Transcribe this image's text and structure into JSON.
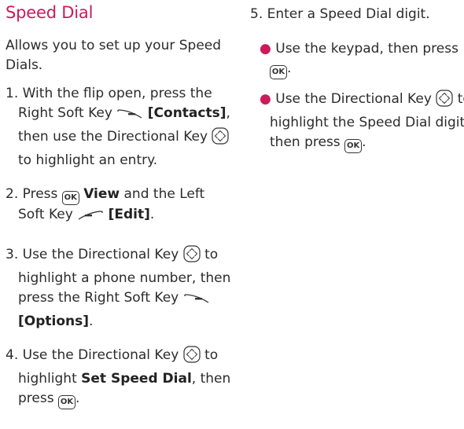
{
  "left": {
    "title": "Speed Dial",
    "intro": "Allows you to set up your Speed Dials.",
    "step1": {
      "a": "1. With the flip open, press the Right Soft Key",
      "b": "[Contacts]",
      "c": ", then use the Directional Key",
      "d": "to highlight an entry."
    },
    "step2": {
      "a": "2. Press",
      "b": "View",
      "c": "and the Left Soft Key",
      "d": "[Edit]",
      "e": "."
    },
    "step3": {
      "a": "3. Use the Directional Key",
      "b": "to highlight a phone number, then press the Right Soft Key",
      "c": "[Options]",
      "d": "."
    },
    "step4": {
      "a": "4. Use the Directional Key",
      "b": "to highlight",
      "c": "Set Speed Dial",
      "d": ", then press",
      "e": "."
    }
  },
  "right": {
    "step5": "5. Enter a Speed Dial digit.",
    "bullet1": {
      "a": "Use the keypad, then press",
      "b": "."
    },
    "bullet2": {
      "a": "Use the Directional Key",
      "b": "to highlight the Speed Dial digit, then press",
      "c": "."
    }
  },
  "icons": {
    "ok_label": "OK",
    "ok": "ok-key-icon",
    "directional": "directional-key-icon",
    "right_soft": "right-soft-key-icon",
    "left_soft": "left-soft-key-icon"
  },
  "colors": {
    "accent": "#cc1a5a",
    "text": "#2b2b2b"
  }
}
